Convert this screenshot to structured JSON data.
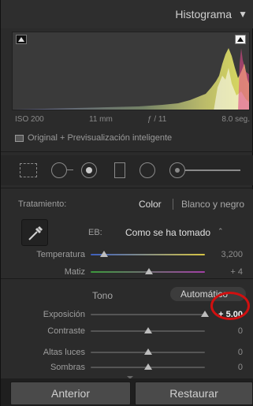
{
  "histogram": {
    "title": "Histograma",
    "collapse_arrow": "▼"
  },
  "exif": {
    "iso": "ISO 200",
    "focal": "11 mm",
    "aperture": "ƒ / 11",
    "shutter": "8.0 seg."
  },
  "preview": {
    "label": "Original + Previsualización inteligente"
  },
  "tools": [
    "crop-overlay",
    "spot-removal",
    "red-eye",
    "graduated-filter",
    "radial-filter",
    "adjustment-brush"
  ],
  "basic": {
    "treatment_label": "Tratamiento:",
    "treatment_color": "Color",
    "treatment_bw": "Blanco y negro",
    "wb_label": "EB:",
    "wb_value": "Como se ha tomado",
    "wb_arrow": "⌃",
    "tone_label": "Tono",
    "auto_label": "Automático",
    "sliders": [
      {
        "label": "Temperatura",
        "value": "3,200",
        "position": 0.12,
        "kind": "temp"
      },
      {
        "label": "Matiz",
        "value": "+ 4",
        "position": 0.51,
        "kind": "tint"
      },
      {
        "label": "Exposición",
        "value": "+ 5.00",
        "position": 1.0,
        "kind": "plain"
      },
      {
        "label": "Contraste",
        "value": "0",
        "position": 0.5,
        "kind": "plain"
      },
      {
        "label": "Altas luces",
        "value": "0",
        "position": 0.5,
        "kind": "plain"
      },
      {
        "label": "Sombras",
        "value": "0",
        "position": 0.5,
        "kind": "plain"
      }
    ]
  },
  "buttons": {
    "previous": "Anterior",
    "reset": "Restaurar"
  },
  "colors": {
    "panel_bg": "#2b2b2b",
    "highlight_circle": "#d01010"
  }
}
